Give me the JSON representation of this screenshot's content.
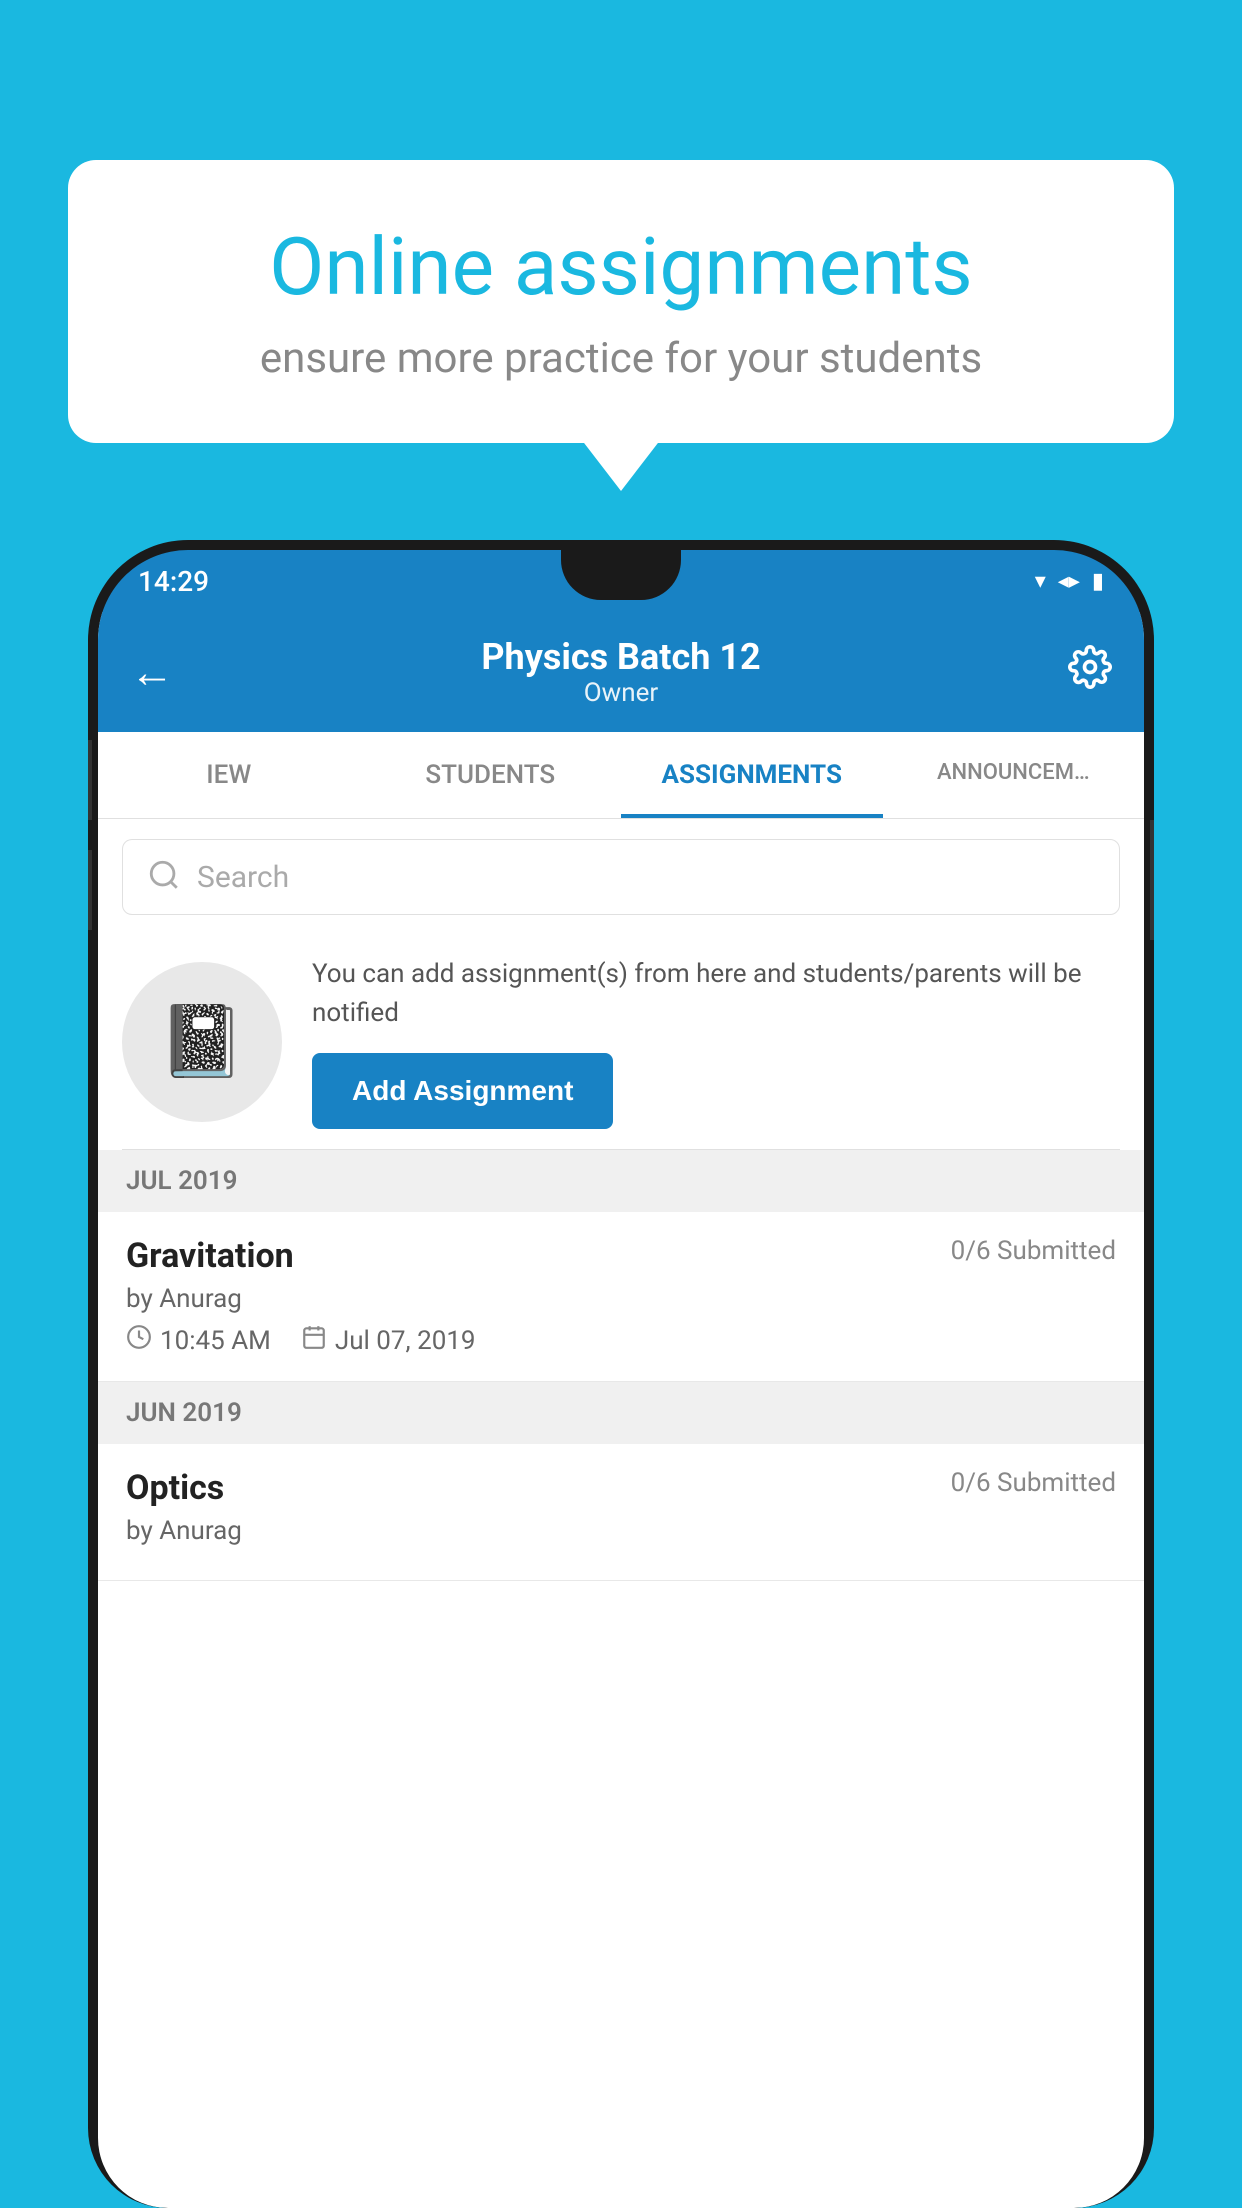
{
  "background": {
    "color": "#1ab8e0"
  },
  "speech_bubble": {
    "title": "Online assignments",
    "subtitle": "ensure more practice for your students"
  },
  "status_bar": {
    "time": "14:29",
    "wifi": "▼",
    "signal": "▲",
    "battery": "▮"
  },
  "header": {
    "title": "Physics Batch 12",
    "subtitle": "Owner",
    "back_label": "←",
    "settings_label": "⚙"
  },
  "tabs": [
    {
      "label": "IEW",
      "active": false
    },
    {
      "label": "STUDENTS",
      "active": false
    },
    {
      "label": "ASSIGNMENTS",
      "active": true
    },
    {
      "label": "ANNOUNCEM…",
      "active": false
    }
  ],
  "search": {
    "placeholder": "Search"
  },
  "promo": {
    "description": "You can add assignment(s) from here and students/parents will be notified",
    "button_label": "Add Assignment"
  },
  "sections": [
    {
      "label": "JUL 2019",
      "assignments": [
        {
          "name": "Gravitation",
          "submitted": "0/6 Submitted",
          "by": "by Anurag",
          "time": "10:45 AM",
          "date": "Jul 07, 2019"
        }
      ]
    },
    {
      "label": "JUN 2019",
      "assignments": [
        {
          "name": "Optics",
          "submitted": "0/6 Submitted",
          "by": "by Anurag",
          "time": "",
          "date": ""
        }
      ]
    }
  ]
}
